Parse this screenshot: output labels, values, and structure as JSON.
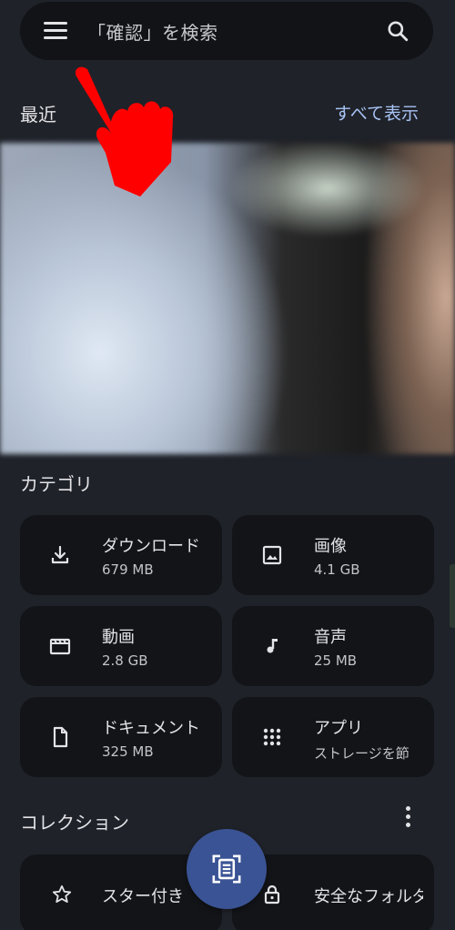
{
  "search": {
    "placeholder": "「確認」を検索"
  },
  "recent": {
    "title": "最近",
    "show_all": "すべて表示"
  },
  "categories": {
    "title": "カテゴリ",
    "items": [
      {
        "label": "ダウンロード",
        "size": "679 MB",
        "icon": "download-icon"
      },
      {
        "label": "画像",
        "size": "4.1 GB",
        "icon": "image-icon"
      },
      {
        "label": "動画",
        "size": "2.8 GB",
        "icon": "movie-clapper-icon"
      },
      {
        "label": "音声",
        "size": "25 MB",
        "icon": "music-note-icon"
      },
      {
        "label": "ドキュメント",
        "size": "325 MB",
        "icon": "document-icon"
      },
      {
        "label": "アプリ",
        "size": "ストレージを節",
        "icon": "apps-grid-icon"
      }
    ]
  },
  "collections": {
    "title": "コレクション",
    "items": [
      {
        "label": "スター付き",
        "icon": "star-icon"
      },
      {
        "label": "安全なフォルダ",
        "icon": "lock-icon"
      }
    ]
  },
  "colors": {
    "background": "#1f2229",
    "card": "#121418",
    "accent": "#a8c3f5",
    "fab": "#3a5394",
    "pointer": "#ff0000"
  }
}
